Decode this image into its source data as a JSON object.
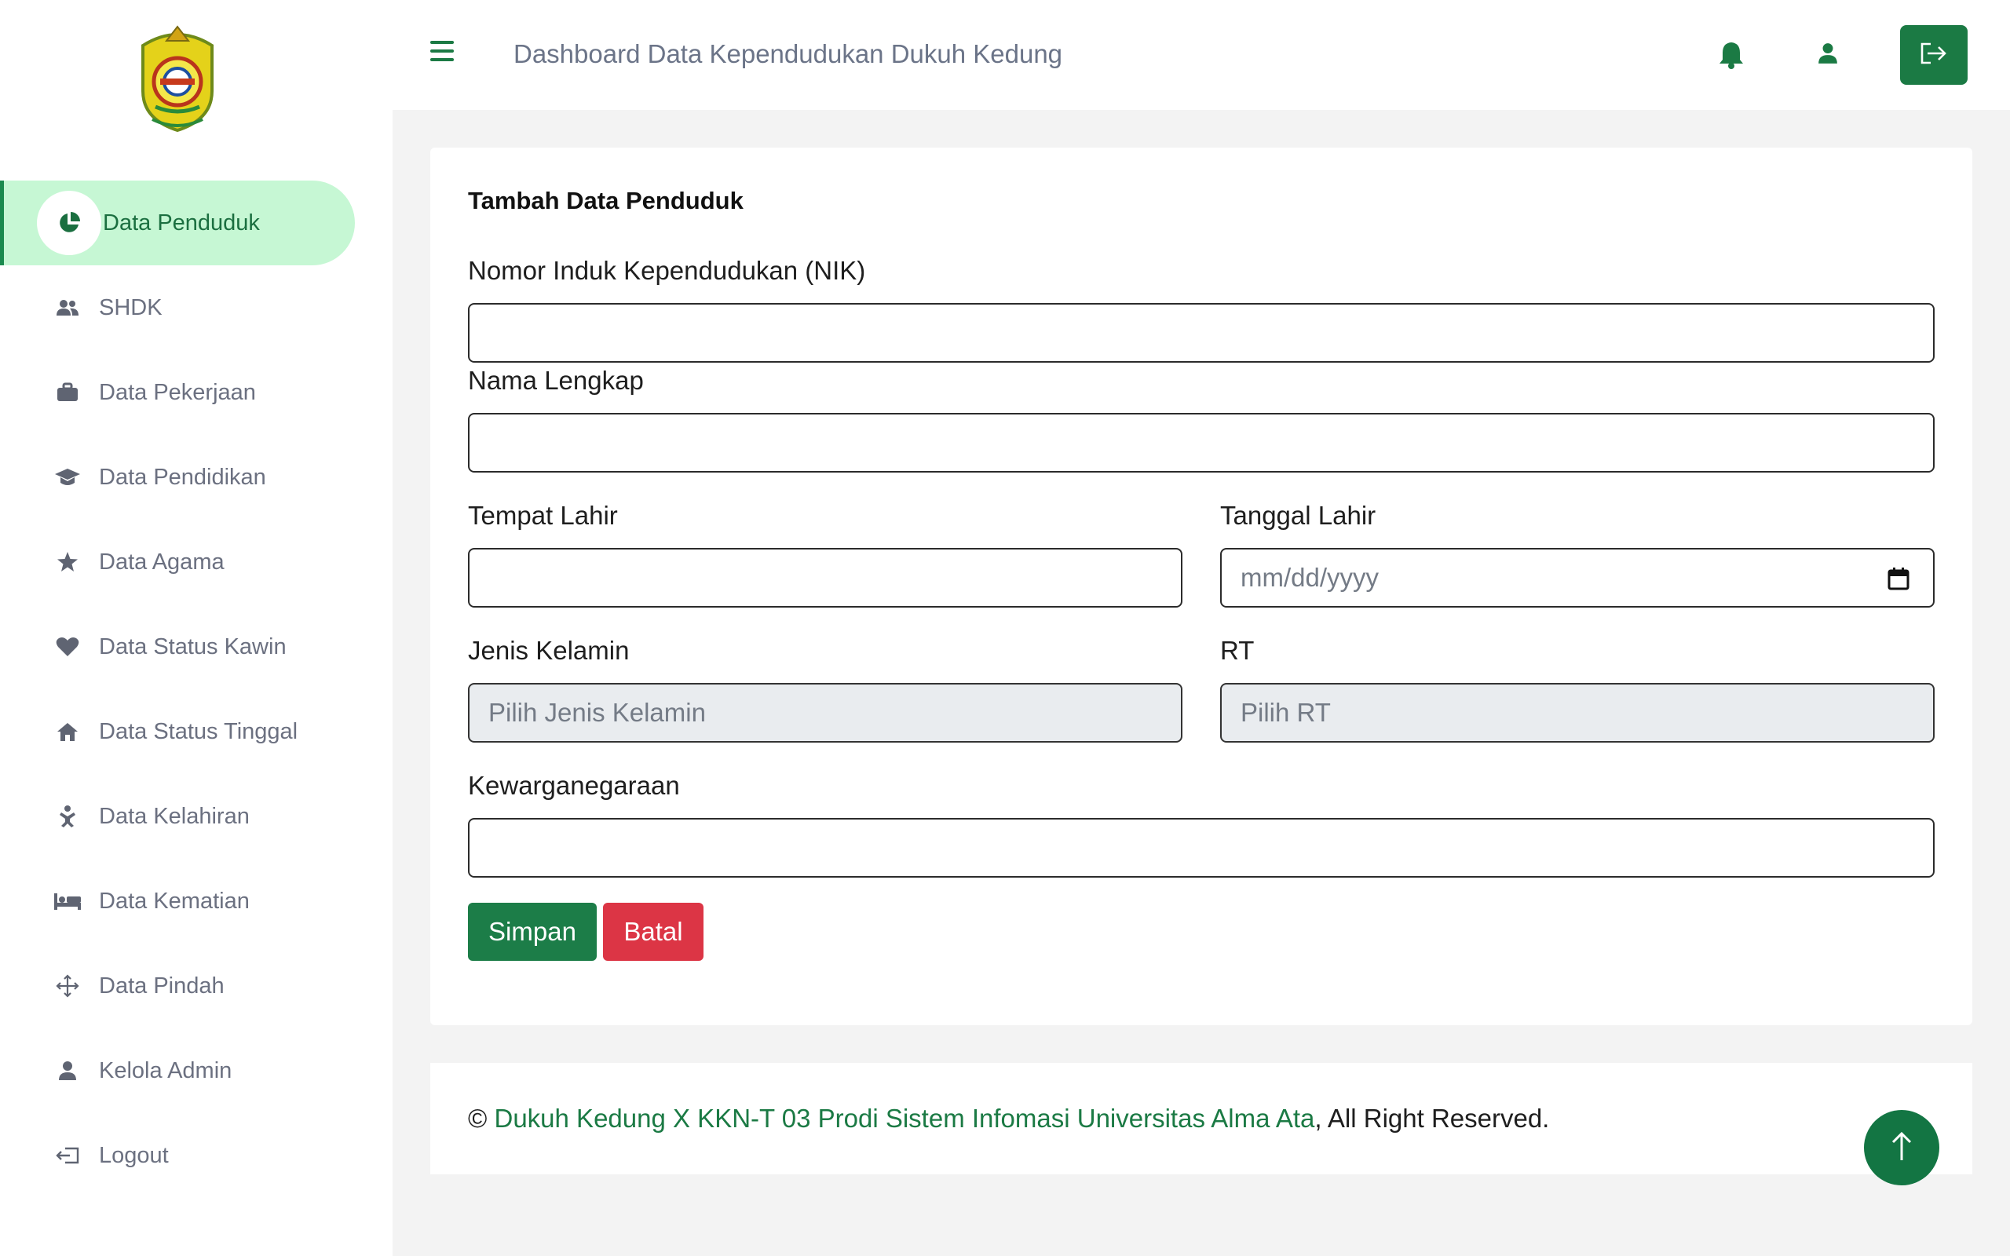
{
  "header": {
    "title": "Dashboard Data Kependudukan Dukuh Kedung",
    "menu_icon": "hamburger-icon",
    "notification_icon": "bell-icon",
    "user_icon": "user-icon",
    "logout_icon": "logout-icon"
  },
  "sidebar": {
    "items": [
      {
        "label": "Data Penduduk",
        "icon": "pie-chart-icon",
        "active": true
      },
      {
        "label": "SHDK",
        "icon": "users-icon"
      },
      {
        "label": "Data Pekerjaan",
        "icon": "briefcase-icon"
      },
      {
        "label": "Data Pendidikan",
        "icon": "graduation-cap-icon"
      },
      {
        "label": "Data Agama",
        "icon": "star-icon"
      },
      {
        "label": "Data Status Kawin",
        "icon": "heart-icon"
      },
      {
        "label": "Data Status Tinggal",
        "icon": "home-icon"
      },
      {
        "label": "Data Kelahiran",
        "icon": "baby-icon"
      },
      {
        "label": "Data Kematian",
        "icon": "bed-icon"
      },
      {
        "label": "Data Pindah",
        "icon": "move-icon"
      },
      {
        "label": "Kelola Admin",
        "icon": "user-icon"
      },
      {
        "label": "Logout",
        "icon": "sign-out-icon"
      }
    ]
  },
  "form": {
    "title": "Tambah Data Penduduk",
    "nik_label": "Nomor Induk Kependudukan (NIK)",
    "nik_value": "",
    "nama_label": "Nama Lengkap",
    "nama_value": "",
    "tempat_label": "Tempat Lahir",
    "tempat_value": "",
    "tanggal_label": "Tanggal Lahir",
    "tanggal_placeholder": "mm/dd/yyyy",
    "jk_label": "Jenis Kelamin",
    "jk_selected": "Pilih Jenis Kelamin",
    "rt_label": "RT",
    "rt_selected": "Pilih RT",
    "kewarganegaraan_label": "Kewarganegaraan",
    "kewarganegaraan_value": "",
    "save_label": "Simpan",
    "cancel_label": "Batal"
  },
  "footer": {
    "copyright": "©",
    "link_text": "Dukuh Kedung X KKN-T 03 Prodi Sistem Infomasi Universitas Alma Ata",
    "suffix": ", All Right Reserved."
  },
  "colors": {
    "accent": "#1b7a44",
    "active_bg": "#c6f7d4",
    "danger": "#dc3545"
  }
}
